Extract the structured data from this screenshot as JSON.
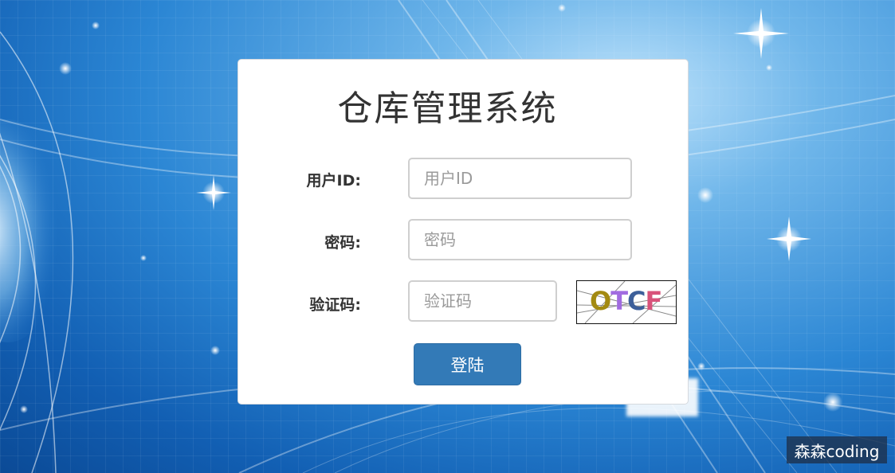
{
  "page": {
    "title": "仓库管理系统"
  },
  "form": {
    "user_id": {
      "label": "用户ID:",
      "placeholder": "用户ID",
      "value": ""
    },
    "password": {
      "label": "密码:",
      "placeholder": "密码",
      "value": ""
    },
    "captcha": {
      "label": "验证码:",
      "placeholder": "验证码",
      "value": "",
      "image_text": [
        "O",
        "T",
        "C",
        "F"
      ],
      "image_colors": [
        "#a38a12",
        "#a16be0",
        "#3d5f9a",
        "#d8527a"
      ]
    },
    "login_button_label": "登陆"
  },
  "colors": {
    "primary_button": "#337ab7",
    "panel_background": "#ffffff",
    "background_blue": "#2b86d4"
  },
  "watermark": {
    "text": "森森coding"
  }
}
